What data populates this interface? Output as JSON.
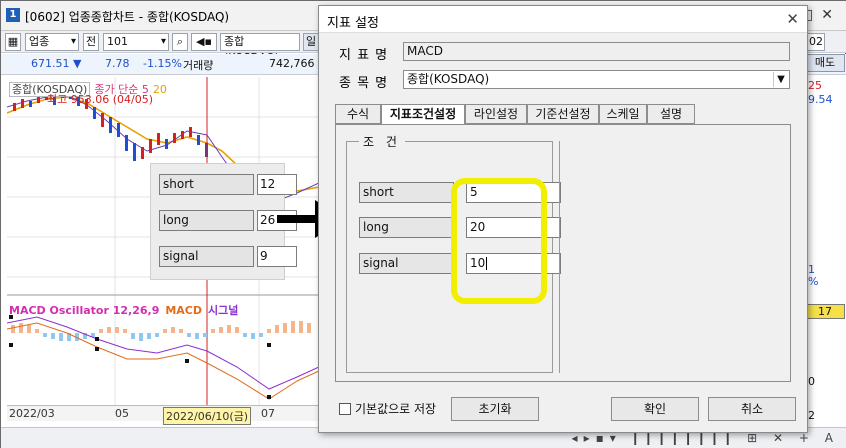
{
  "window": {
    "app_icon": "1",
    "title": "[0602] 업종종합차트 - 종합(KOSDAQ)"
  },
  "toolbar": {
    "market_select": "업종",
    "period_button": "전",
    "code_value": "101",
    "name_value": "종합(KOSDAQ)",
    "partial_button": "일",
    "right_value": "02"
  },
  "quote": {
    "price": "671.51 ▼",
    "change": "7.78",
    "change_rate": "-1.15%",
    "volume_label": "거래량",
    "volume": "742,766"
  },
  "chart": {
    "legend_name": "종합(KOSDAQ)",
    "legend_ma1": "종가 단순 5",
    "legend_ma2": "20",
    "high_label": "최고 953.06 (04/05)",
    "macd_legend": "MACD Oscillator 12,26,9",
    "macd_label": "MACD",
    "signal_label": "시그널",
    "dates": [
      "2022/03",
      "05",
      "2022/06/10(금)",
      "07"
    ]
  },
  "right_strip": {
    "sell_button": "매도",
    "value_red": "25",
    "value_blue": "9.54",
    "value_blue2": "1",
    "value_blue3": "%",
    "value_box": "17",
    "value_bottom": "0",
    "value_bottom2": "2"
  },
  "overlay_params": [
    {
      "label": "short",
      "value": "12"
    },
    {
      "label": "long",
      "value": "26"
    },
    {
      "label": "signal",
      "value": "9"
    }
  ],
  "dialog": {
    "title": "지표 설정",
    "indicator_label": "지 표 명",
    "indicator_value": "MACD",
    "item_label": "종 목 명",
    "item_value": "종합(KOSDAQ)",
    "tabs": [
      "수식",
      "지표조건설정",
      "라인설정",
      "기준선설정",
      "스케일",
      "설명"
    ],
    "active_tab": "지표조건설정",
    "group_title": "조 건",
    "conditions": [
      {
        "label": "short",
        "value": "5"
      },
      {
        "label": "long",
        "value": "20"
      },
      {
        "label": "signal",
        "value": "10"
      }
    ],
    "save_default_label": "기본값으로 저장",
    "reset_button": "초기화",
    "ok_button": "확인",
    "cancel_button": "취소"
  },
  "icons": {
    "close": "close-icon",
    "search": "search-icon",
    "arrow": "right-arrow-icon"
  },
  "colors": {
    "highlight": "#f2ee00",
    "up": "#d42020",
    "down": "#1f4fd1",
    "ma_orange": "#e7a100"
  }
}
